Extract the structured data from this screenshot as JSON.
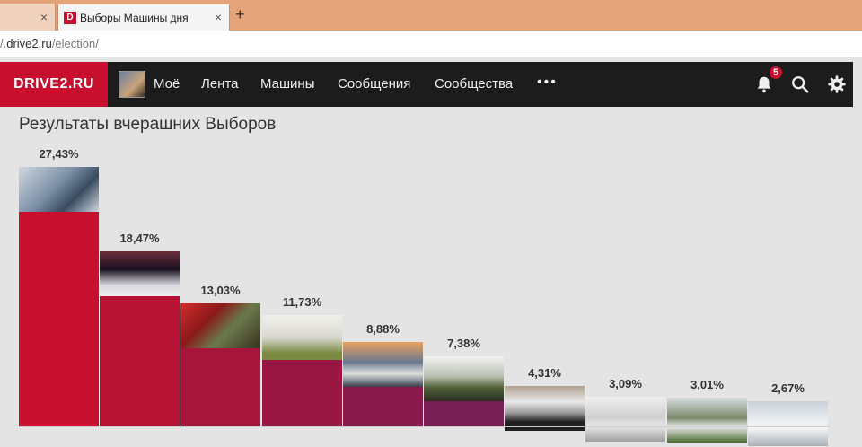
{
  "browser": {
    "tabs": [
      {
        "label": ""
      },
      {
        "label": "Выборы Машины дня",
        "favicon": "D"
      }
    ],
    "new_tab": "+",
    "close": "×",
    "url_prefix": "/.",
    "url_host": "drive2.ru",
    "url_path": "/election/"
  },
  "site": {
    "logo": "DRIVE2.RU",
    "nav": [
      "Моё",
      "Лента",
      "Машины",
      "Сообщения",
      "Сообщества"
    ],
    "more": "•••",
    "notifications_count": "5",
    "icons": [
      "bell-icon",
      "search-icon",
      "gear-icon"
    ]
  },
  "page": {
    "heading": "Результаты вчерашних Выборов"
  },
  "chart_data": {
    "type": "bar",
    "categories": [
      "1",
      "2",
      "3",
      "4",
      "5",
      "6",
      "7",
      "8",
      "9",
      "10"
    ],
    "values": [
      27.43,
      18.47,
      13.03,
      11.73,
      8.88,
      7.38,
      4.31,
      3.09,
      3.01,
      2.67
    ],
    "labels": [
      "27,43%",
      "18,47%",
      "13,03%",
      "11,73%",
      "8,88%",
      "7,38%",
      "4,31%",
      "3,09%",
      "3,01%",
      "2,67%"
    ],
    "colors": [
      "#c8102e",
      "#b71335",
      "#a8153c",
      "#991742",
      "#881a4b",
      "#782055",
      "#68265f",
      "#553272",
      "#483a80",
      "#354a98"
    ],
    "ylim": [
      0,
      27.43
    ],
    "grid": false
  }
}
